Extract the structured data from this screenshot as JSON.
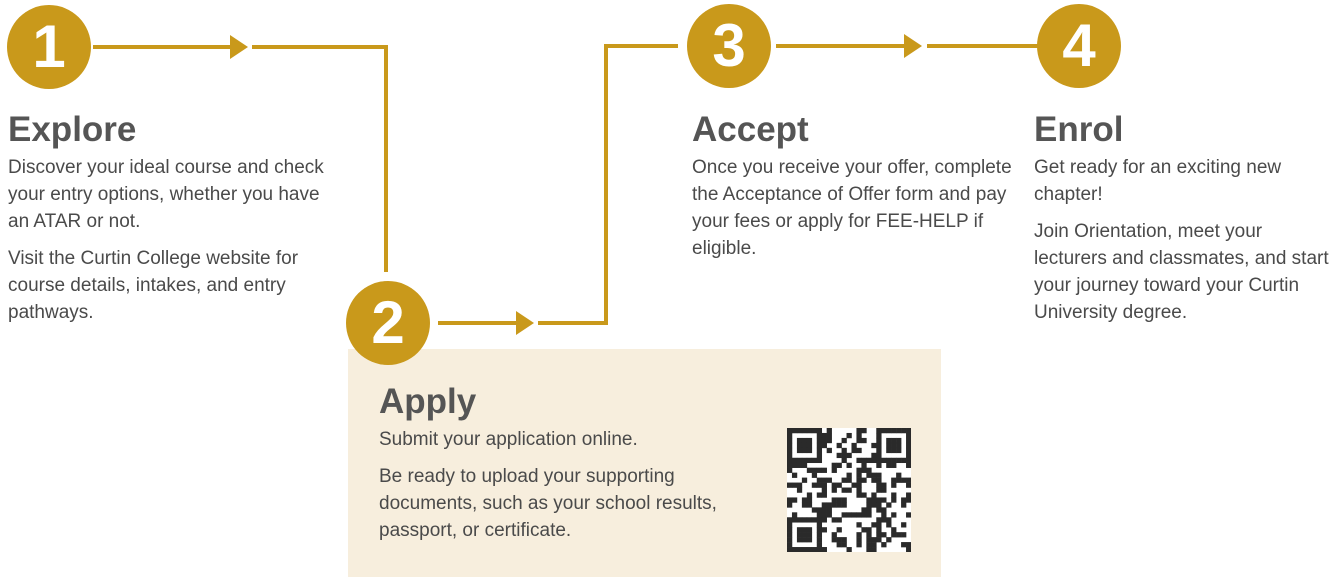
{
  "colors": {
    "accent": "#c9991b",
    "apply_box": "#f7eedd",
    "title": "#555555",
    "body_text": "#4a4a4a"
  },
  "steps": [
    {
      "number": "1",
      "title": "Explore",
      "paragraphs": [
        "Discover your ideal course and check your entry options, whether you have an ATAR or not.",
        "Visit the Curtin College website for course details, intakes, and entry pathways."
      ]
    },
    {
      "number": "2",
      "title": "Apply",
      "paragraphs": [
        "Submit your application online.",
        "Be ready to upload your supporting documents, such as your school results, passport, or certificate."
      ],
      "qr_code": "qr-code-icon"
    },
    {
      "number": "3",
      "title": "Accept",
      "paragraphs": [
        "Once you receive your offer, complete the Acceptance of Offer form and pay your fees or apply for FEE-HELP if eligible."
      ]
    },
    {
      "number": "4",
      "title": "Enrol",
      "paragraphs": [
        "Get ready for an exciting new chapter!",
        "Join Orientation, meet your lecturers and classmates, and start your journey toward your Curtin University degree."
      ]
    }
  ]
}
